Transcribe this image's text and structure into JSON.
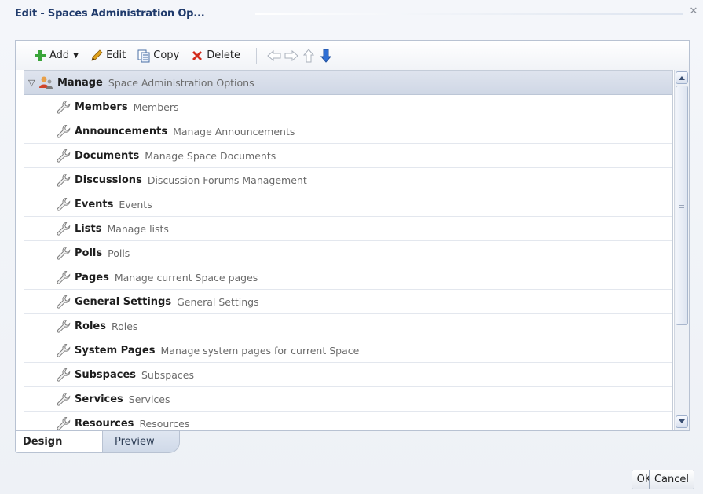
{
  "dialog": {
    "title": "Edit - Spaces Administration Op...",
    "close_icon": "close-icon"
  },
  "toolbar": {
    "add_label": "Add",
    "edit_label": "Edit",
    "copy_label": "Copy",
    "delete_label": "Delete",
    "icons": [
      "add-icon",
      "pencil-icon",
      "copy-icon",
      "delete-icon",
      "arrow-left-icon",
      "arrow-right-icon",
      "arrow-up-icon",
      "arrow-down-icon"
    ]
  },
  "tree": {
    "root": {
      "name": "Manage",
      "description": "Space Administration Options",
      "icon": "users-icon"
    },
    "children": [
      {
        "name": "Members",
        "description": "Members"
      },
      {
        "name": "Announcements",
        "description": "Manage Announcements"
      },
      {
        "name": "Documents",
        "description": "Manage Space Documents"
      },
      {
        "name": "Discussions",
        "description": "Discussion Forums Management"
      },
      {
        "name": "Events",
        "description": "Events"
      },
      {
        "name": "Lists",
        "description": "Manage lists"
      },
      {
        "name": "Polls",
        "description": "Polls"
      },
      {
        "name": "Pages",
        "description": "Manage current Space pages"
      },
      {
        "name": "General Settings",
        "description": "General Settings"
      },
      {
        "name": "Roles",
        "description": "Roles"
      },
      {
        "name": "System Pages",
        "description": "Manage system pages for current Space"
      },
      {
        "name": "Subspaces",
        "description": "Subspaces"
      },
      {
        "name": "Services",
        "description": "Services"
      },
      {
        "name": "Resources",
        "description": "Resources"
      }
    ],
    "child_icon": "wrench-icon"
  },
  "tabs": [
    {
      "label": "Design",
      "selected": true
    },
    {
      "label": "Preview",
      "selected": false
    }
  ],
  "buttons": {
    "ok_label": "OK",
    "cancel_label": "Cancel"
  },
  "colors": {
    "title": "#1f3a6b",
    "root_row": "#d6dde9",
    "add_green": "#3aa53a",
    "delete_red": "#d22b1c",
    "down_arrow_blue": "#2f6fd4"
  }
}
